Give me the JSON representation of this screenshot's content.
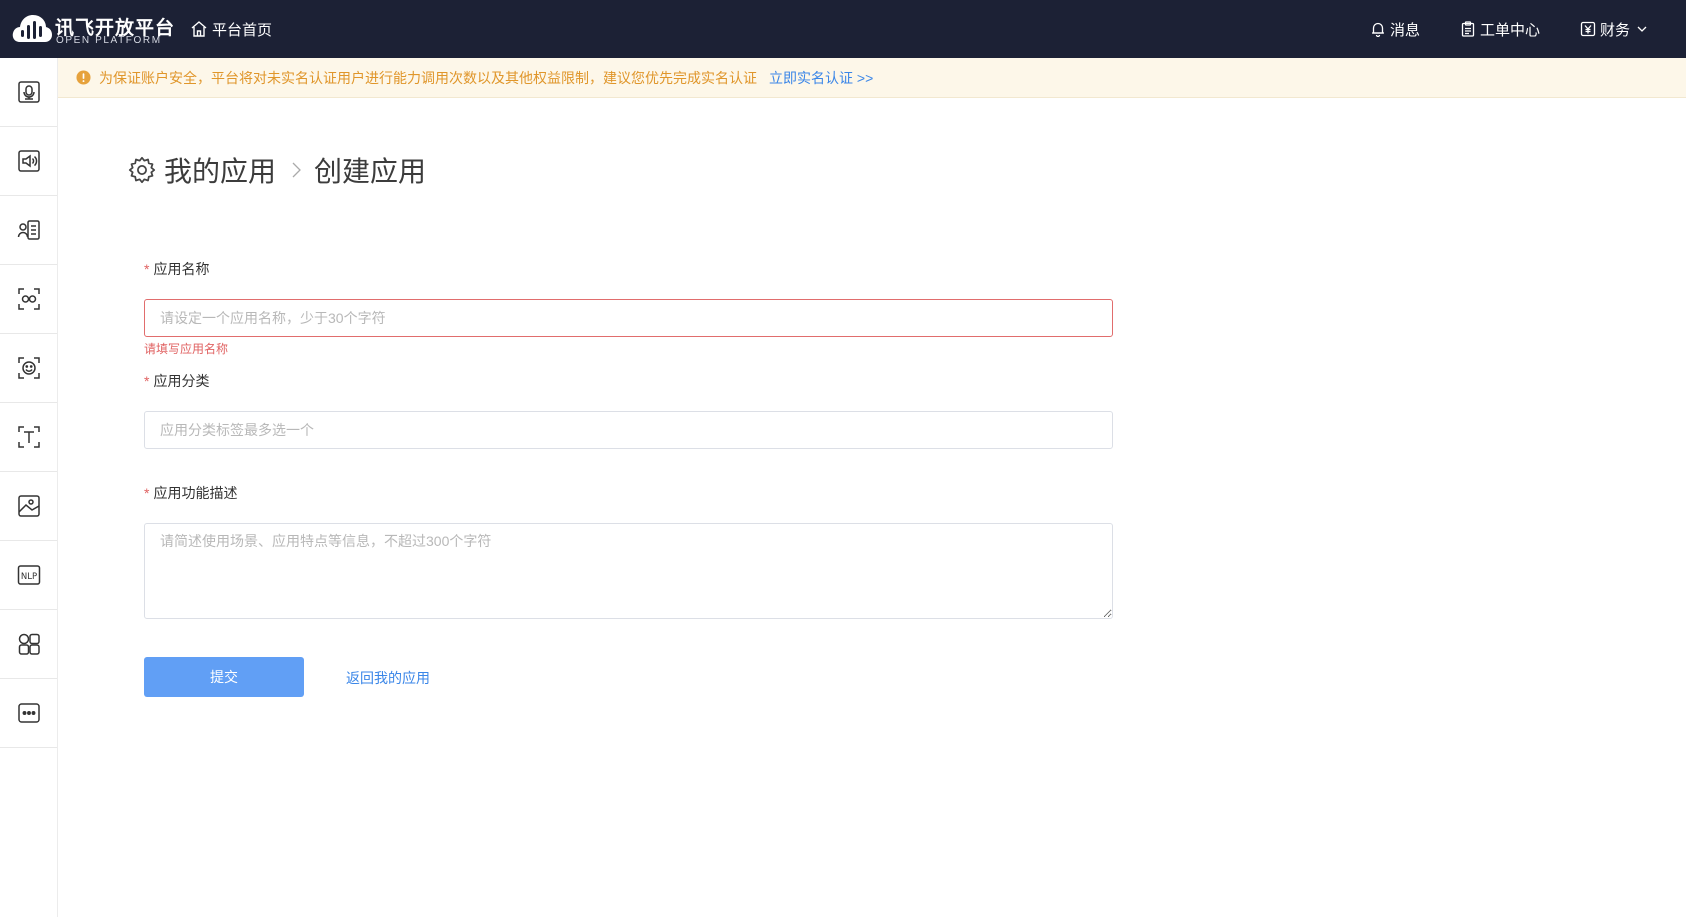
{
  "brand": {
    "name_cn": "讯飞开放平台",
    "name_en": "OPEN PLATFORM"
  },
  "nav": {
    "home_label": "平台首页"
  },
  "top_right": {
    "messages": "消息",
    "tickets": "工单中心",
    "finance": "财务"
  },
  "sidebar": {
    "items": [
      {
        "icon": "voice-assistant-icon"
      },
      {
        "icon": "audio-speaker-icon"
      },
      {
        "icon": "voice-document-icon"
      },
      {
        "icon": "face-scan-icon"
      },
      {
        "icon": "face-smile-icon"
      },
      {
        "icon": "text-recognition-icon"
      },
      {
        "icon": "image-icon"
      },
      {
        "icon": "nlp-icon"
      },
      {
        "icon": "apps-grid-icon"
      },
      {
        "icon": "more-icon"
      }
    ]
  },
  "notice": {
    "text": "为保证账户安全，平台将对未实名认证用户进行能力调用次数以及其他权益限制，建议您优先完成实名认证",
    "link": "立即实名认证 >>"
  },
  "breadcrumb": {
    "parent": "我的应用",
    "current": "创建应用"
  },
  "form": {
    "required_mark": "*",
    "app_name": {
      "label": "应用名称",
      "placeholder": "请设定一个应用名称，少于30个字符",
      "value": "",
      "error": "请填写应用名称"
    },
    "category": {
      "label": "应用分类",
      "placeholder": "应用分类标签最多选一个",
      "value": ""
    },
    "description": {
      "label": "应用功能描述",
      "placeholder": "请简述使用场景、应用特点等信息，不超过300个字符",
      "value": ""
    },
    "submit_label": "提交",
    "back_label": "返回我的应用"
  },
  "colors": {
    "topbar": "#1c2135",
    "accent": "#3a86e8",
    "button": "#619ff5",
    "error": "#e06262",
    "notice_bg": "#fdf7e9",
    "notice_text": "#e0962a"
  }
}
